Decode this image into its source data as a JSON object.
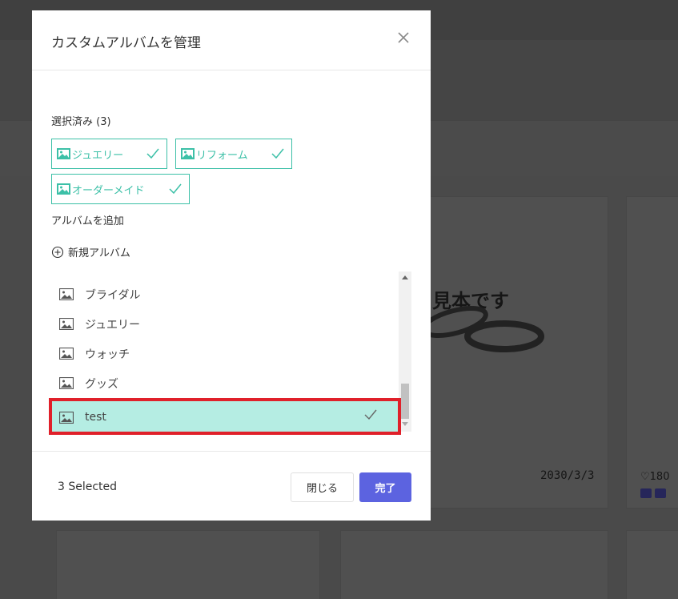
{
  "background": {
    "sample_text": "見本です",
    "date": "2030/3/3",
    "likes": "♡180"
  },
  "modal": {
    "title": "カスタムアルバムを管理",
    "selected_label": "選択済み (3)",
    "chips": [
      {
        "label": "ジュエリー"
      },
      {
        "label": "リフォーム"
      },
      {
        "label": "オーダーメイド"
      }
    ],
    "add_label": "アルバムを追加",
    "new_album_label": "新規アルバム",
    "albums": [
      {
        "label": "ブライダル",
        "selected": false
      },
      {
        "label": "ジュエリー",
        "selected": false
      },
      {
        "label": "ウォッチ",
        "selected": false
      },
      {
        "label": "グッズ",
        "selected": false
      },
      {
        "label": "test",
        "selected": true
      }
    ],
    "footer": {
      "selected_count": "3 Selected",
      "close_label": "閉じる",
      "done_label": "完了"
    }
  },
  "colors": {
    "accent_teal": "#3cc0a7",
    "selected_row": "#b5ede3",
    "primary_button": "#5c63e0",
    "highlight_red": "#e0202a"
  }
}
